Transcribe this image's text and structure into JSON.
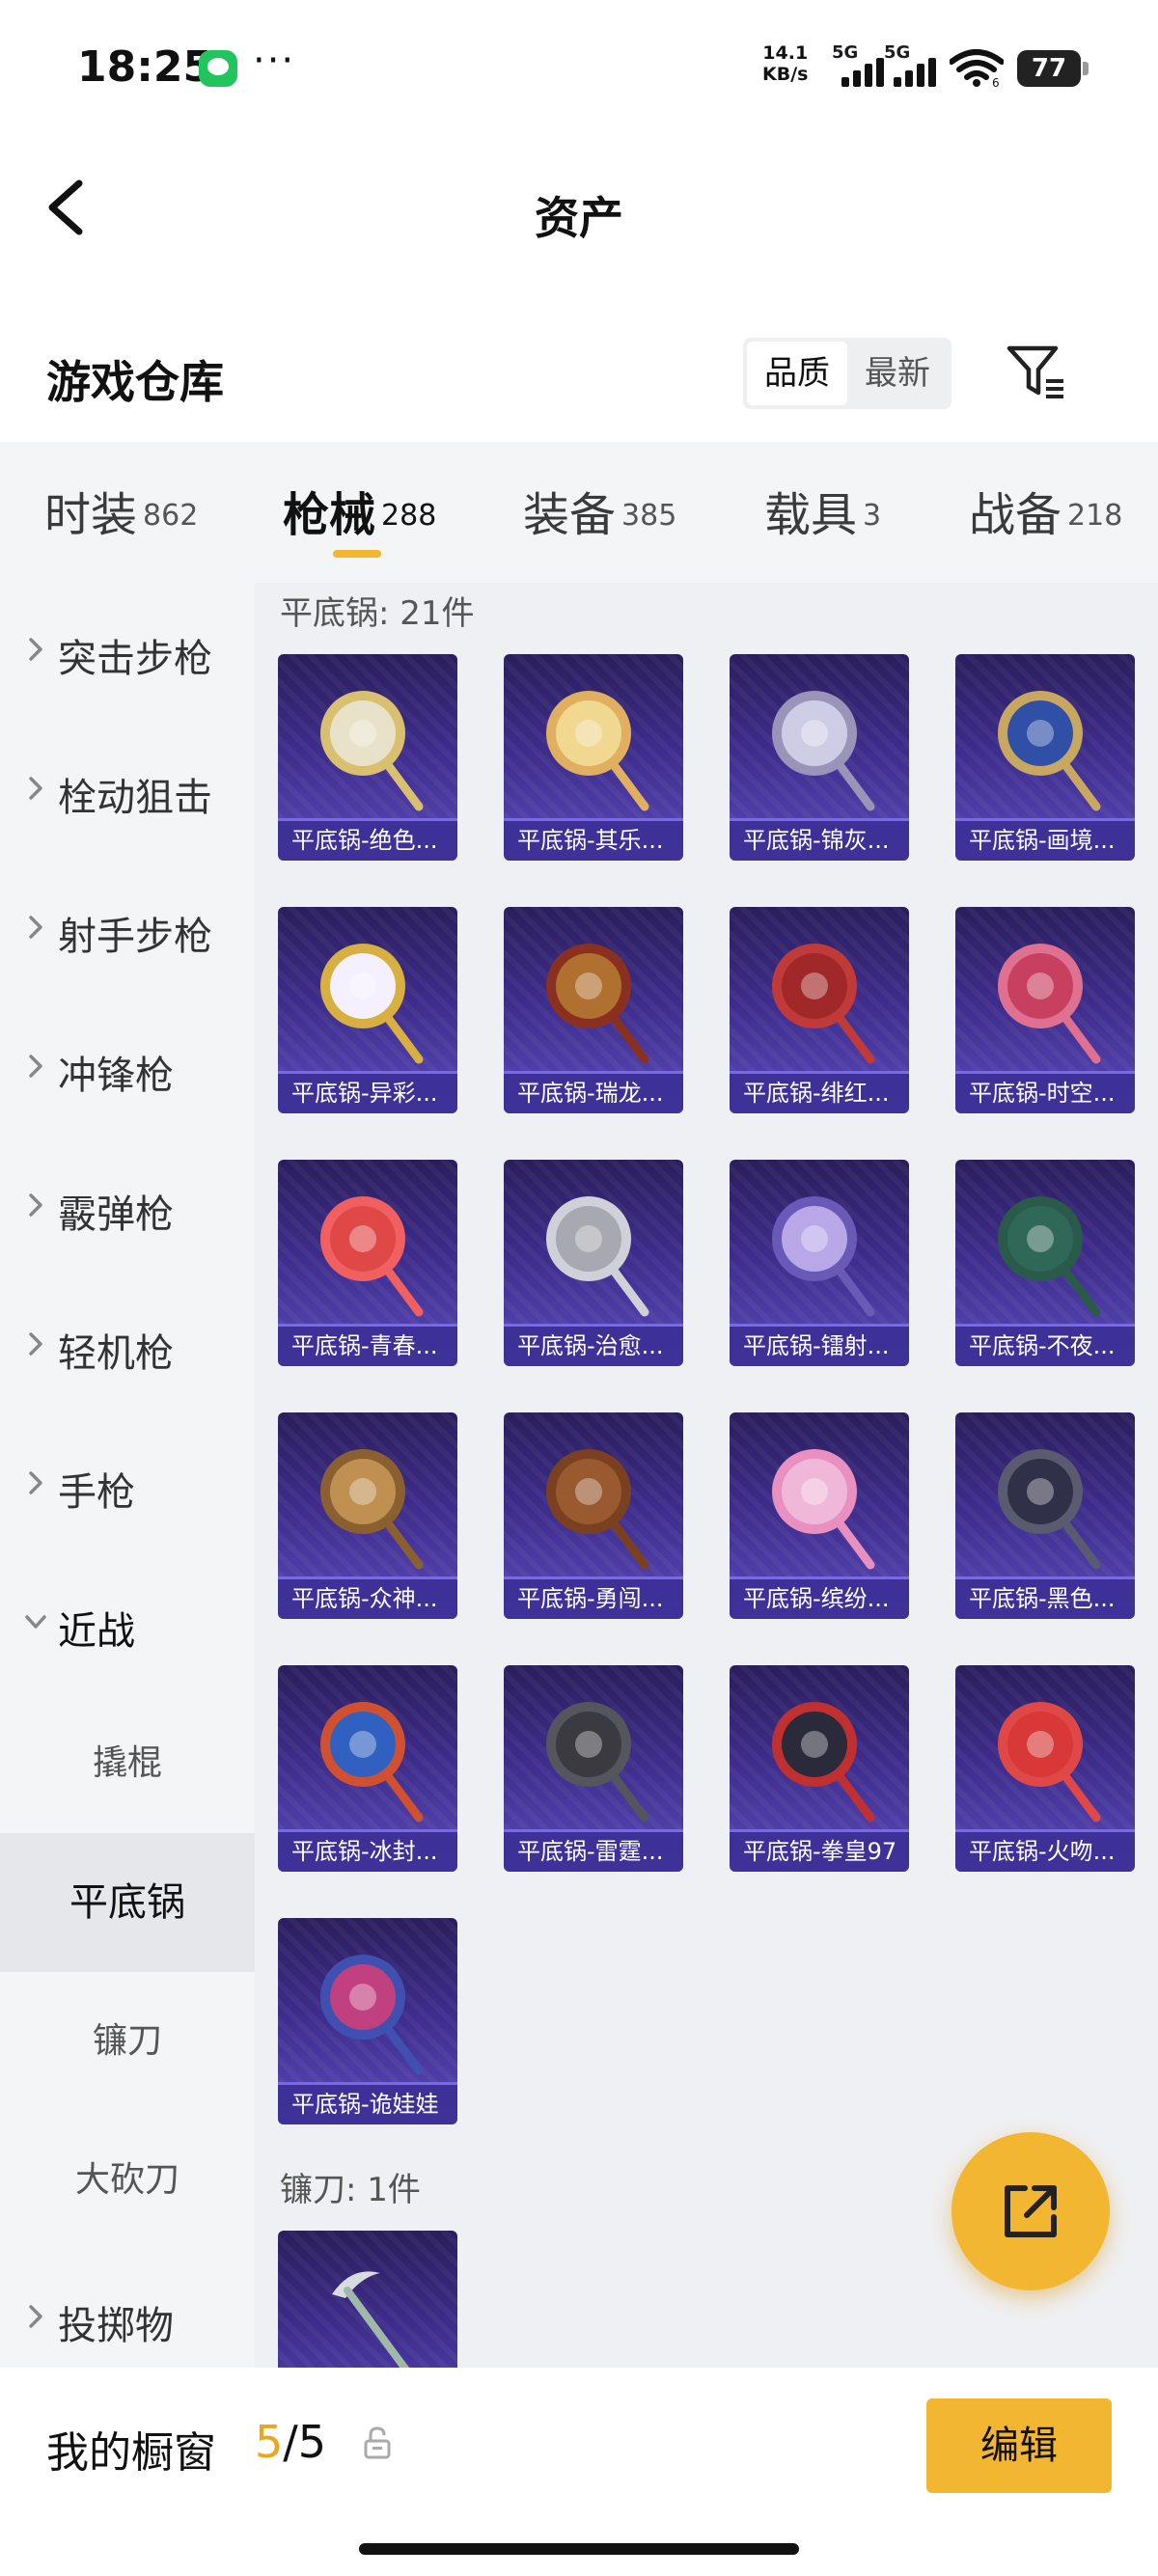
{
  "status_bar": {
    "time": "18:25",
    "more": "···",
    "net_speed_value": "14.1",
    "net_speed_unit": "KB/s",
    "signal_1": "5G",
    "signal_2": "5G",
    "wifi_badge": "6",
    "battery": "77"
  },
  "header": {
    "title": "资产"
  },
  "section": {
    "title": "游戏仓库",
    "sort_options": [
      "品质",
      "最新"
    ],
    "sort_selected": "品质"
  },
  "tabs": [
    {
      "label": "时装",
      "count": "862"
    },
    {
      "label": "枪械",
      "count": "288",
      "active": true
    },
    {
      "label": "装备",
      "count": "385"
    },
    {
      "label": "载具",
      "count": "3"
    },
    {
      "label": "战备",
      "count": "218"
    }
  ],
  "sidebar": {
    "categories": [
      "突击步枪",
      "栓动狙击",
      "射手步枪",
      "冲锋枪",
      "霰弹枪",
      "轻机枪",
      "手枪"
    ],
    "expanded": "近战",
    "sub_items": [
      "撬棍",
      "平底锅",
      "镰刀",
      "大砍刀"
    ],
    "sub_selected": "平底锅",
    "after": "投掷物"
  },
  "groups": [
    {
      "title": "平底锅: 21件",
      "items": [
        {
          "name": "平底锅-绝色...",
          "accent": "#e8e2c8",
          "rim": "#d8c070"
        },
        {
          "name": "平底锅-其乐...",
          "accent": "#f0d890",
          "rim": "#e0b060"
        },
        {
          "name": "平底锅-锦灰...",
          "accent": "#cfcde6",
          "rim": "#9a94b8"
        },
        {
          "name": "平底锅-画境...",
          "accent": "#3050a8",
          "rim": "#c8a860"
        },
        {
          "name": "平底锅-异彩...",
          "accent": "#f5f0ff",
          "rim": "#d8b040"
        },
        {
          "name": "平底锅-瑞龙...",
          "accent": "#b07030",
          "rim": "#8a3020"
        },
        {
          "name": "平底锅-绯红...",
          "accent": "#a02828",
          "rim": "#c03a3a"
        },
        {
          "name": "平底锅-时空...",
          "accent": "#c84060",
          "rim": "#e07090"
        },
        {
          "name": "平底锅-青春...",
          "accent": "#e04848",
          "rim": "#f06060"
        },
        {
          "name": "平底锅-治愈...",
          "accent": "#a8a8b0",
          "rim": "#d0d0d8"
        },
        {
          "name": "平底锅-镭射...",
          "accent": "#b8a8e8",
          "rim": "#6a5ab8"
        },
        {
          "name": "平底锅-不夜...",
          "accent": "#306858",
          "rim": "#2a5a4a"
        },
        {
          "name": "平底锅-众神...",
          "accent": "#c09050",
          "rim": "#8a6030"
        },
        {
          "name": "平底锅-勇闯...",
          "accent": "#9a5a30",
          "rim": "#7a4020"
        },
        {
          "name": "平底锅-缤纷...",
          "accent": "#f0b8d8",
          "rim": "#e890c0"
        },
        {
          "name": "平底锅-黑色...",
          "accent": "#303048",
          "rim": "#5a5a70"
        },
        {
          "name": "平底锅-冰封...",
          "accent": "#3060c0",
          "rim": "#d05030"
        },
        {
          "name": "平底锅-雷霆...",
          "accent": "#3a3a40",
          "rim": "#55555e"
        },
        {
          "name": "平底锅-拳皇97",
          "accent": "#2a2a3a",
          "rim": "#c03030"
        },
        {
          "name": "平底锅-火吻...",
          "accent": "#d83838",
          "rim": "#e04848"
        },
        {
          "name": "平底锅-诡娃娃",
          "accent": "#c04080",
          "rim": "#4050b0"
        }
      ]
    },
    {
      "title": "镰刀: 1件",
      "items": [
        {
          "name": "",
          "accent": "#d8dce0",
          "rim": "#a0b8a8"
        }
      ]
    }
  ],
  "bottom_bar": {
    "label": "我的橱窗",
    "current": "5",
    "total": "/5",
    "edit": "编辑"
  },
  "colors": {
    "accent_yellow": "#f3b630",
    "card_bg": "#3d2c8a"
  }
}
